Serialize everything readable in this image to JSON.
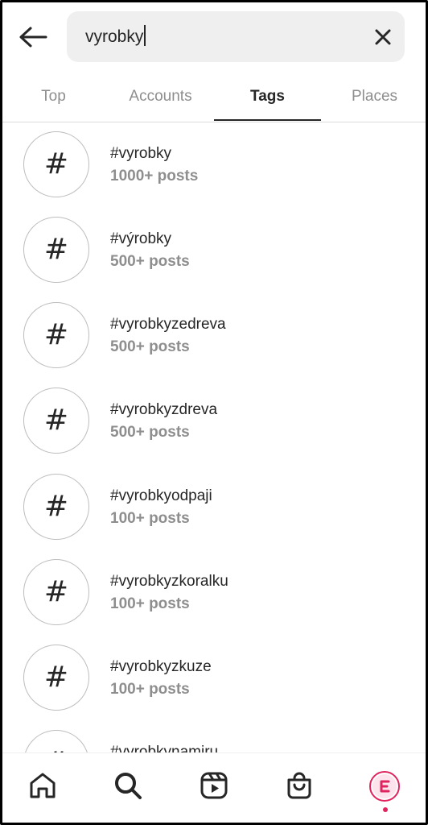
{
  "search": {
    "value": "vyrobky",
    "clear_icon": "close-icon",
    "back_icon": "arrow-left-icon"
  },
  "tabs": [
    {
      "label": "Top",
      "active": false
    },
    {
      "label": "Accounts",
      "active": false
    },
    {
      "label": "Tags",
      "active": true
    },
    {
      "label": "Places",
      "active": false
    }
  ],
  "results": [
    {
      "name": "#vyrobky",
      "count": "1000+ posts"
    },
    {
      "name": "#výrobky",
      "count": "500+ posts"
    },
    {
      "name": "#vyrobkyzedreva",
      "count": "500+ posts"
    },
    {
      "name": "#vyrobkyzdreva",
      "count": "500+ posts"
    },
    {
      "name": "#vyrobkyodpaji",
      "count": "100+ posts"
    },
    {
      "name": "#vyrobkyzkoralku",
      "count": "100+ posts"
    },
    {
      "name": "#vyrobkyzkuze",
      "count": "100+ posts"
    },
    {
      "name": "#vyrobkynamiru",
      "count": ""
    }
  ],
  "hash_symbol": "#",
  "bottom_nav": {
    "items": [
      "home-icon",
      "search-icon",
      "reels-icon",
      "shop-icon",
      "profile-avatar"
    ],
    "profile_letter": "E"
  },
  "colors": {
    "accent": "#e0245e",
    "muted": "#8e8e8e",
    "text": "#262626"
  }
}
